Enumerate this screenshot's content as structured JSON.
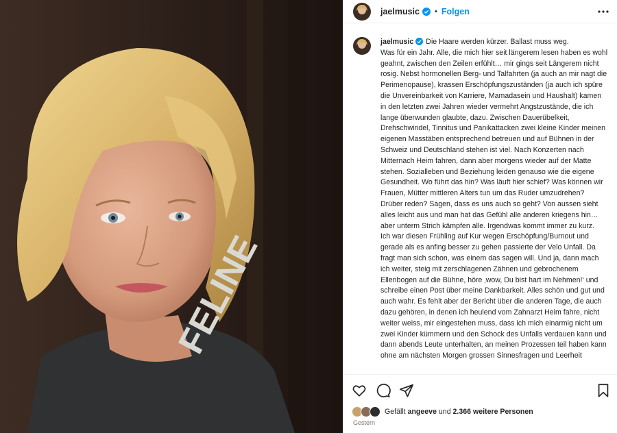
{
  "header": {
    "username": "jaelmusic",
    "dot": "•",
    "follow_label": "Folgen"
  },
  "caption": {
    "username": "jaelmusic",
    "text": "Die Haare werden kürzer. Ballast muss weg.\nWas für ein Jahr. Alle, die mich hier seit längerem lesen haben es wohl geahnt, zwischen den Zeilen erfühlt… mir gings seit Längerem nicht rosig. Nebst hormonellen Berg- und Talfahrten (ja auch an mir nagt die Perimenopause), krassen Erschöpfungszuständen (ja auch ich spüre die Unvereinbarkeit von Karriere, Mamadasein und Haushalt) kamen in den letzten zwei Jahren wieder vermehrt Angstzustände, die ich lange überwunden glaubte, dazu. Zwischen Dauerübelkeit, Drehschwindel, Tinnitus und Panikattacken zwei kleine Kinder meinen eigenen Masstäben entsprechend betreuen und auf Bühnen in der Schweiz und Deutschland stehen ist viel. Nach Konzerten nach Mitternach Heim fahren, dann aber morgens wieder auf der Matte stehen. Sozialleben und Beziehung leiden genauso wie die eigene Gesundheit. Wo führt das hin? Was läuft hier schief? Was können wir Frauen, Mütter mittleren Alters tun um das Ruder umzudrehen? Drüber reden? Sagen, dass es uns auch so geht? Von aussen sieht alles leicht aus und man hat das Gefühl alle anderen kriegens hin… aber unterm Strich kämpfen alle. Irgendwas kommt immer zu kurz.\nIch war diesen Frühling auf Kur wegen Erschöpfung/Burnout und gerade als es anfing besser zu gehen passierte der Velo Unfall. Da fragt man sich schon, was einem das sagen will. Und ja, dann mach ich weiter, steig mit zerschlagenen Zähnen und gebrochenem Ellenbogen auf die Bühne, höre ‚wow, Du bist hart im Nehmen!‘ und schreibe einen Post über meine Dankbarkeit. Alles schön und gut und auch wahr. Es fehlt aber der Bericht über die anderen Tage, die auch dazu gehören, in denen ich heulend vom Zahnarzt Heim fahre, nicht weiter weiss, mir eingestehen muss, dass ich mich einarmig nicht um zwei Kinder kümmern und den Schock des Unfalls verdauen kann und dann abends Leute unterhalten, an meinen Prozessen teil haben kann ohne am nächsten Morgen grossen Sinnesfragen und Leerheit"
  },
  "photo": {
    "shirt_text": "FELINE"
  },
  "likes": {
    "prefix": "Gefällt ",
    "user": "angeeve",
    "middle": " und ",
    "count": "2.366 weitere Personen"
  },
  "date": "Gestern",
  "icons": {
    "more": "more-horizontal-icon",
    "like": "heart-icon",
    "comment": "comment-icon",
    "share": "share-icon",
    "save": "bookmark-icon",
    "verified": "verified-badge-icon"
  },
  "colors": {
    "accent": "#0095f6",
    "text": "#262626",
    "muted": "#737373",
    "divider": "#efefef"
  }
}
